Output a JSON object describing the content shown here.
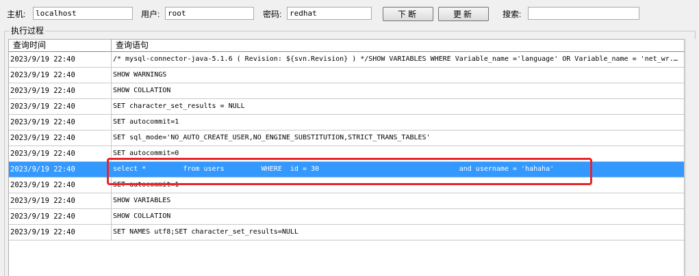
{
  "toolbar": {
    "host_label": "主机:",
    "host_value": "localhost",
    "user_label": "用户:",
    "user_value": "root",
    "password_label": "密码:",
    "password_value": "redhat",
    "stop_button": "下断",
    "refresh_button": "更新",
    "search_label": "搜索:",
    "search_value": ""
  },
  "group": {
    "label": "执行过程"
  },
  "grid": {
    "columns": {
      "time": "查询时间",
      "sql": "查询语句"
    },
    "rows": [
      {
        "time": "2023/9/19 22:40",
        "sql": "/* mysql-connector-java-5.1.6 ( Revision: ${svn.Revision} ) */SHOW VARIABLES WHERE Variable_name ='language' OR Variable_name = 'net_wr..."
      },
      {
        "time": "2023/9/19 22:40",
        "sql": "SHOW WARNINGS"
      },
      {
        "time": "2023/9/19 22:40",
        "sql": "SHOW COLLATION"
      },
      {
        "time": "2023/9/19 22:40",
        "sql": "SET character_set_results = NULL"
      },
      {
        "time": "2023/9/19 22:40",
        "sql": "SET autocommit=1"
      },
      {
        "time": "2023/9/19 22:40",
        "sql": "SET sql_mode='NO_AUTO_CREATE_USER,NO_ENGINE_SUBSTITUTION,STRICT_TRANS_TABLES'"
      },
      {
        "time": "2023/9/19 22:40",
        "sql": "SET autocommit=0"
      },
      {
        "time": "2023/9/19 22:40",
        "sql": "select *         from users         WHERE  id = 30                                  and username = 'hahaha'"
      },
      {
        "time": "2023/9/19 22:40",
        "sql": "SET autocommit=1"
      },
      {
        "time": "2023/9/19 22:40",
        "sql": "SHOW VARIABLES"
      },
      {
        "time": "2023/9/19 22:40",
        "sql": "SHOW COLLATION"
      },
      {
        "time": "2023/9/19 22:40",
        "sql": "SET NAMES utf8;SET character_set_results=NULL"
      }
    ],
    "selected_index": 7
  },
  "colors": {
    "selection": "#3399ff",
    "highlight_box": "#e8232b"
  }
}
